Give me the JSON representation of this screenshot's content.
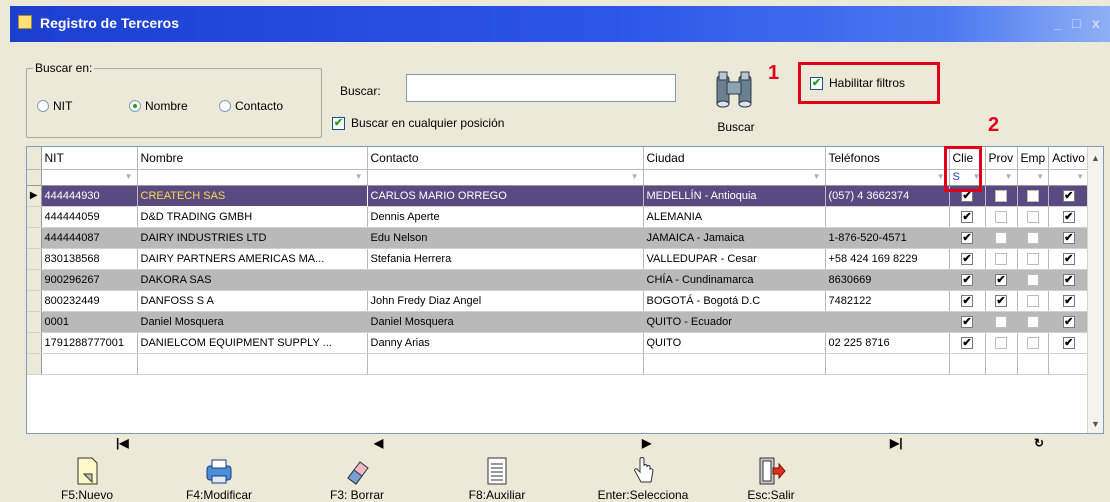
{
  "window": {
    "title": "Registro de Terceros",
    "controls": [
      "_",
      "□",
      "x"
    ]
  },
  "search": {
    "group_label": "Buscar en:",
    "options": [
      {
        "label": "NIT",
        "selected": false
      },
      {
        "label": "Nombre",
        "selected": true
      },
      {
        "label": "Contacto",
        "selected": false
      }
    ],
    "buscar_label": "Buscar:",
    "query_value": "",
    "anywhere_label": "Buscar en cualquier posición",
    "anywhere_checked": true,
    "button_label": "Buscar",
    "filters_label": "Habilitar filtros",
    "filters_checked": true
  },
  "annotations": {
    "one": "1",
    "two": "2"
  },
  "grid": {
    "columns": [
      "NIT",
      "Nombre",
      "Contacto",
      "Ciudad",
      "Teléfonos",
      "Clie",
      "Prov",
      "Emp",
      "Activo"
    ],
    "filter_clie": "S",
    "rows": [
      {
        "nit": "444444930",
        "nombre": "CREATECH SAS",
        "contacto": "CARLOS MARIO ORREGO",
        "ciudad": "MEDELLÍN - Antioquia",
        "telefonos": "(057) 4 3662374",
        "clie": true,
        "prov": false,
        "emp": false,
        "activo": true
      },
      {
        "nit": "444444059",
        "nombre": "D&D TRADING GMBH",
        "contacto": "Dennis Aperte",
        "ciudad": "ALEMANIA",
        "telefonos": "",
        "clie": true,
        "prov": false,
        "emp": false,
        "activo": true
      },
      {
        "nit": "444444087",
        "nombre": "DAIRY INDUSTRIES LTD",
        "contacto": "Edu Nelson",
        "ciudad": "JAMAICA - Jamaica",
        "telefonos": "1-876-520-4571",
        "clie": true,
        "prov": false,
        "emp": false,
        "activo": true
      },
      {
        "nit": "830138568",
        "nombre": "DAIRY PARTNERS AMERICAS MA...",
        "contacto": "Stefania Herrera",
        "ciudad": "VALLEDUPAR - Cesar",
        "telefonos": "+58 424 169 8229",
        "clie": true,
        "prov": false,
        "emp": false,
        "activo": true
      },
      {
        "nit": "900296267",
        "nombre": "DAKORA SAS",
        "contacto": "",
        "ciudad": "CHÍA - Cundinamarca",
        "telefonos": "8630669",
        "clie": true,
        "prov": true,
        "emp": false,
        "activo": true
      },
      {
        "nit": "800232449",
        "nombre": "DANFOSS S A",
        "contacto": "John Fredy Diaz Angel",
        "ciudad": "BOGOTÁ - Bogotá D.C",
        "telefonos": "7482122",
        "clie": true,
        "prov": true,
        "emp": false,
        "activo": true
      },
      {
        "nit": "0001",
        "nombre": "Daniel Mosquera",
        "contacto": "Daniel Mosquera",
        "ciudad": "QUITO - Ecuador",
        "telefonos": "",
        "clie": true,
        "prov": false,
        "emp": false,
        "activo": true
      },
      {
        "nit": "1791288777001",
        "nombre": "DANIELCOM EQUIPMENT SUPPLY ...",
        "contacto": "Danny Arias",
        "ciudad": "QUITO",
        "telefonos": "02 225 8716",
        "clie": true,
        "prov": false,
        "emp": false,
        "activo": true
      }
    ]
  },
  "toolbar": {
    "nuevo": "F5:Nuevo",
    "modificar": "F4:Modificar",
    "borrar": "F3: Borrar",
    "auxiliar": "F8:Auxiliar",
    "selecciona": "Enter:Selecciona",
    "salir": "Esc:Salir"
  },
  "colors": {
    "accent": "#e0001a",
    "selected_row": "#5a4a82",
    "titlebar": "#2b56e8"
  }
}
